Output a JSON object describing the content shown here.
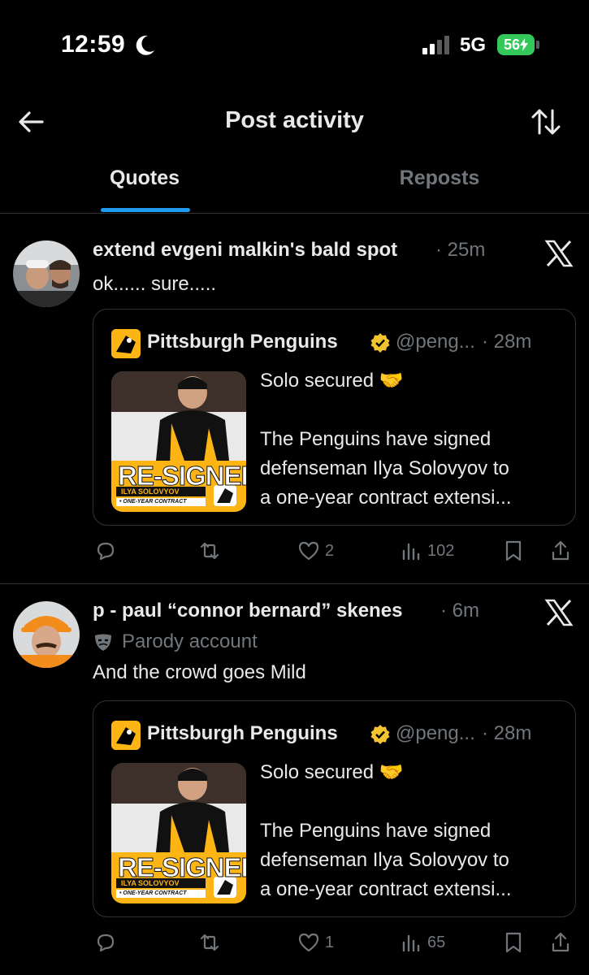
{
  "status_bar": {
    "time": "12:59",
    "network": "5G",
    "battery": "56"
  },
  "header": {
    "title": "Post activity"
  },
  "tabs": [
    {
      "label": "Quotes",
      "active": true
    },
    {
      "label": "Reposts",
      "active": false
    }
  ],
  "posts": [
    {
      "author": "extend evgeni malkin's bald spot",
      "time": "· 25m",
      "text": "ok...... sure.....",
      "quote": {
        "name": "Pittsburgh Penguins",
        "handle": "@peng...",
        "time": "· 28m",
        "graphic_title": "RE-SIGNED",
        "graphic_player": "ILYA SOLOVYOV",
        "graphic_sub": "• ONE-YEAR CONTRACT",
        "lines": [
          "Solo secured 🤝",
          "",
          "The Penguins have signed",
          "defenseman Ilya Solovyov to",
          "a one-year contract extensi..."
        ]
      },
      "actions": {
        "likes": "2",
        "views": "102"
      }
    },
    {
      "author": "p - paul “connor bernard” skenes",
      "time": "· 6m",
      "label": "Parody account",
      "text": "And the crowd goes Mild",
      "quote": {
        "name": "Pittsburgh Penguins",
        "handle": "@peng...",
        "time": "· 28m",
        "graphic_title": "RE-SIGNED",
        "graphic_player": "ILYA SOLOVYOV",
        "graphic_sub": "• ONE-YEAR CONTRACT",
        "lines": [
          "Solo secured 🤝",
          "",
          "The Penguins have signed",
          "defenseman Ilya Solovyov to",
          "a one-year contract extensi..."
        ]
      },
      "actions": {
        "likes": "1",
        "views": "65"
      }
    }
  ],
  "colors": {
    "accent": "#1d9bf0",
    "verified": "#f4c430",
    "penguins_gold": "#fcb514",
    "battery": "#34c759"
  }
}
